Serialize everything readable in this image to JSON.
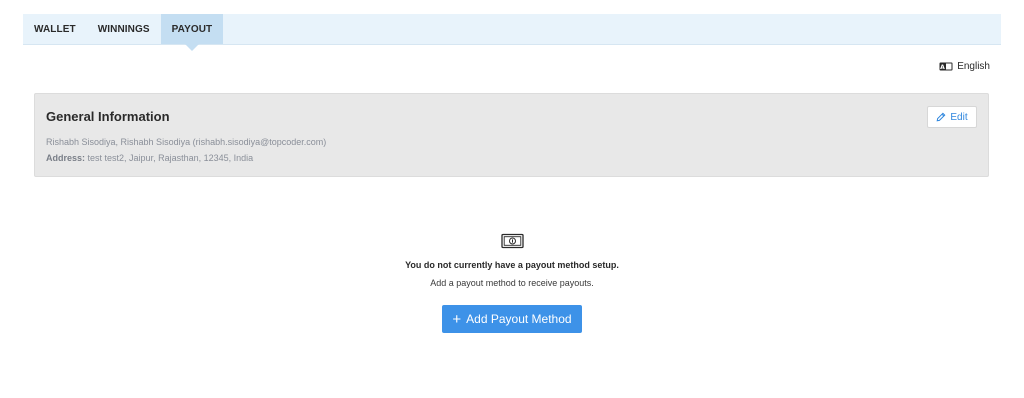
{
  "tabs": [
    {
      "label": "WALLET",
      "active": false
    },
    {
      "label": "WINNINGS",
      "active": false
    },
    {
      "label": "PAYOUT",
      "active": true
    }
  ],
  "language": {
    "label": "English",
    "icon": "language-icon"
  },
  "general_info": {
    "title": "General Information",
    "edit_label": "Edit",
    "edit_icon": "pencil-icon",
    "name_line": "Rishabh Sisodiya, Rishabh Sisodiya (rishabh.sisodiya@topcoder.com)",
    "address_label": "Address:",
    "address_value": "test test2, Jaipur, Rajasthan, 12345, India"
  },
  "empty_state": {
    "icon": "money-icon",
    "title": "You do not currently have a payout method setup.",
    "subtitle": "Add a payout method to receive payouts."
  },
  "add_button": {
    "plus": "+",
    "label": "Add Payout Method"
  },
  "colors": {
    "accent": "#3d92e8",
    "tab_bar": "#e8f3fb",
    "tab_active": "#c4def2",
    "card_bg": "#e8e8e8"
  }
}
